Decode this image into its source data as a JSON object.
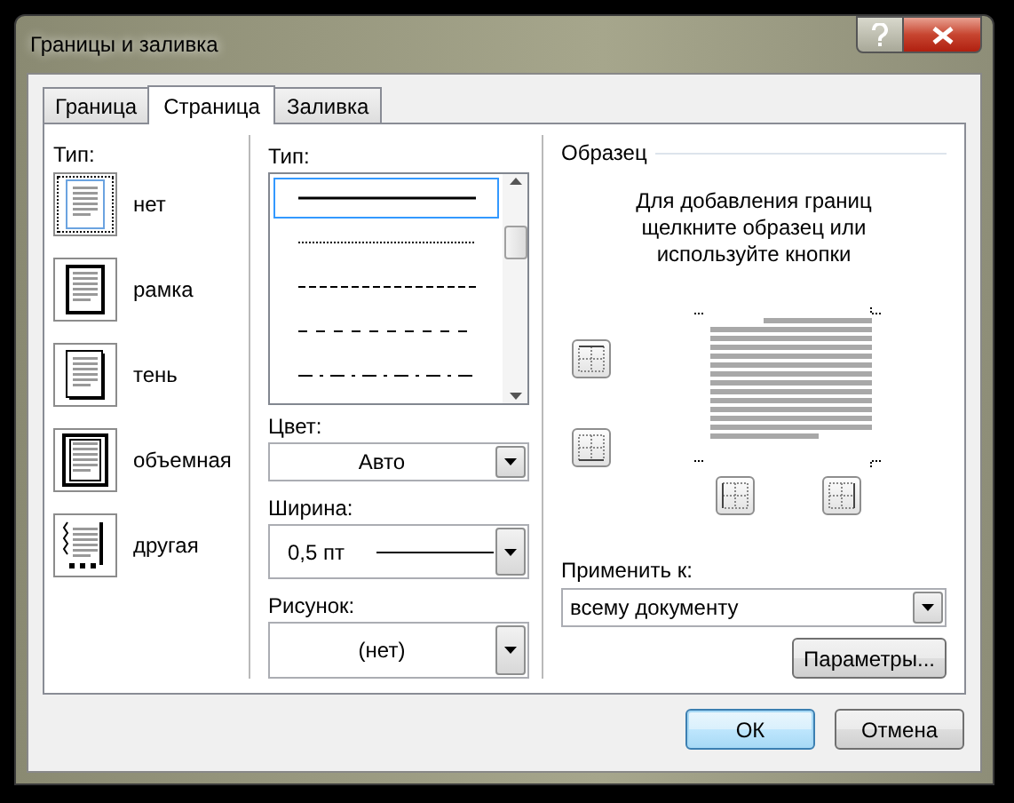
{
  "window": {
    "title": "Границы и заливка"
  },
  "tabs": [
    {
      "label": "Граница",
      "selected": false
    },
    {
      "label": "Страница",
      "selected": true
    },
    {
      "label": "Заливка",
      "selected": false
    }
  ],
  "setting": {
    "label": "Тип:",
    "options": [
      {
        "kind": "none",
        "label": "нет",
        "selected": true
      },
      {
        "kind": "box",
        "label": "рамка",
        "selected": false
      },
      {
        "kind": "shadow",
        "label": "тень",
        "selected": false
      },
      {
        "kind": "volume",
        "label": "объемная",
        "selected": false
      },
      {
        "kind": "custom",
        "label": "другая",
        "selected": false
      }
    ]
  },
  "style": {
    "label": "Тип:",
    "options": [
      {
        "kind": "solid",
        "selected": true
      },
      {
        "kind": "dotted",
        "selected": false
      },
      {
        "kind": "dashed",
        "selected": false
      },
      {
        "kind": "long-dashed",
        "selected": false
      },
      {
        "kind": "dash-dot",
        "selected": false
      }
    ]
  },
  "color": {
    "label": "Цвет:",
    "value": "Авто"
  },
  "width": {
    "label": "Ширина:",
    "value": "0,5 пт"
  },
  "art": {
    "label": "Рисунок:",
    "value": "(нет)"
  },
  "preview": {
    "title": "Образец",
    "hint": "Для добавления границ щелкните образец или используйте кнопки"
  },
  "apply_to": {
    "label": "Применить к:",
    "value": "всему документу"
  },
  "options_button": "Параметры...",
  "buttons": [
    {
      "label": "ОК",
      "focused": true
    },
    {
      "label": "Отмена",
      "focused": false
    }
  ]
}
